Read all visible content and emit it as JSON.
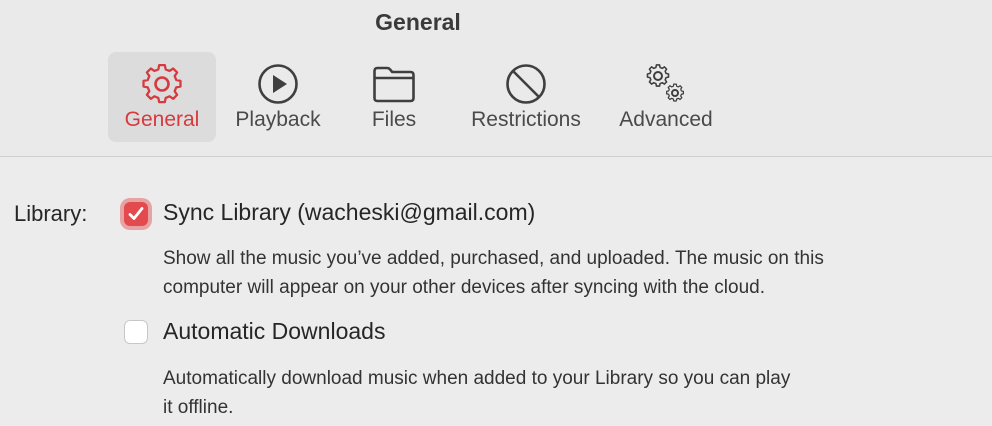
{
  "window": {
    "title": "General"
  },
  "tabs": [
    {
      "label": "General",
      "icon": "gear-icon",
      "selected": true
    },
    {
      "label": "Playback",
      "icon": "play-circle-icon",
      "selected": false
    },
    {
      "label": "Files",
      "icon": "folder-icon",
      "selected": false
    },
    {
      "label": "Restrictions",
      "icon": "prohibited-icon",
      "selected": false
    },
    {
      "label": "Advanced",
      "icon": "gears-icon",
      "selected": false
    }
  ],
  "colors": {
    "accent": "#e24a4e",
    "selected_tab_bg": "#dcdcdc"
  },
  "library": {
    "label": "Library:",
    "options": [
      {
        "title": "Sync Library (wacheski@gmail.com)",
        "checked": true,
        "description_line1": "Show all the music you’ve added, purchased, and uploaded. The music on this",
        "description_line2": "computer will appear on your other devices after syncing with the cloud."
      },
      {
        "title": "Automatic Downloads",
        "checked": false,
        "description_line1": "Automatically download music when added to your Library so you can play",
        "description_line2": "it offline."
      }
    ]
  }
}
